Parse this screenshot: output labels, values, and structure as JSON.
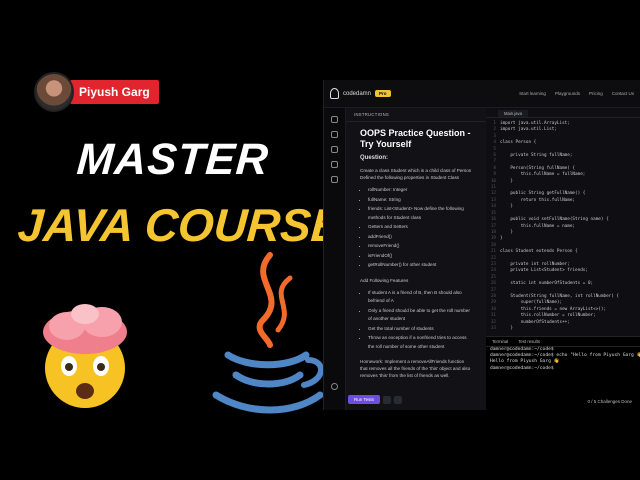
{
  "author": {
    "name": "Piyush Garg"
  },
  "headline": {
    "line1": "MASTER",
    "line2": "JAVA COURSE"
  },
  "colors": {
    "accent_red": "#e1252f",
    "accent_yellow": "#f5c531",
    "run_purple": "#6d4ce8"
  },
  "app": {
    "brand": "codedamn",
    "badge": "Pro",
    "nav": [
      "Start learning",
      "Playgrounds",
      "Pricing",
      "Contact Us"
    ]
  },
  "instructions": {
    "header": "INSTRUCTIONS",
    "title": "OOPS Practice Question - Try Yourself",
    "question_label": "Question:",
    "intro": "Create a class Student which is a child class of Person Defined the following properties in Student Class",
    "properties": [
      "rollNumber: Integer",
      "fullName: String",
      "friends: List<Student> Now define the following methods for Student class",
      "Getters and Setters",
      "addFriend()",
      "removeFriend()",
      "isFriendOf()",
      "getRollNumber() for other student"
    ],
    "features_label": "Add Following Features",
    "features": [
      "If student A is a friend of B, then B should also befriend of A",
      "Only a friend should be able to get the roll number of another student",
      "Get the total number of students",
      "Throw an exception if a nonfriend tries to access the roll number of some other student"
    ],
    "homework": "Homework: Implement a removeAllFriends function that removes all the friends of the 'this' object and also removes 'this' from the list of friends as well.",
    "run_button": "Run Tests"
  },
  "editor": {
    "tab": "Main.java",
    "lines": [
      "import java.util.ArrayList;",
      "import java.util.List;",
      "",
      "class Person {",
      "",
      "    private String fullName;",
      "",
      "    Person(String fullName) {",
      "        this.fullName = fullName;",
      "    }",
      "",
      "    public String getFullName() {",
      "        return this.fullName;",
      "    }",
      "",
      "    public void setFullName(String name) {",
      "        this.fullName = name;",
      "    }",
      "}",
      "",
      "class Student extends Person {",
      "",
      "    private int rollNumber;",
      "    private List<Student> friends;",
      "",
      "    static int numberOfStudents = 0;",
      "",
      "    Student(String fullName, int rollNumber) {",
      "        super(fullName);",
      "        this.friends = new ArrayList<>();",
      "        this.rollNumber = rollNumber;",
      "        numberOfStudents++;",
      "    }"
    ]
  },
  "terminal": {
    "tabs": [
      "Terminal",
      "Test results"
    ],
    "lines": [
      "damner@codedamn:~/code$",
      "damner@codedamn:~/code$ echo \"Hello from Piyush Garg 👋\"",
      "Hello from Piyush Garg 👋",
      "damner@codedamn:~/code$"
    ],
    "footer": "0 / 5 Challenges Done"
  }
}
